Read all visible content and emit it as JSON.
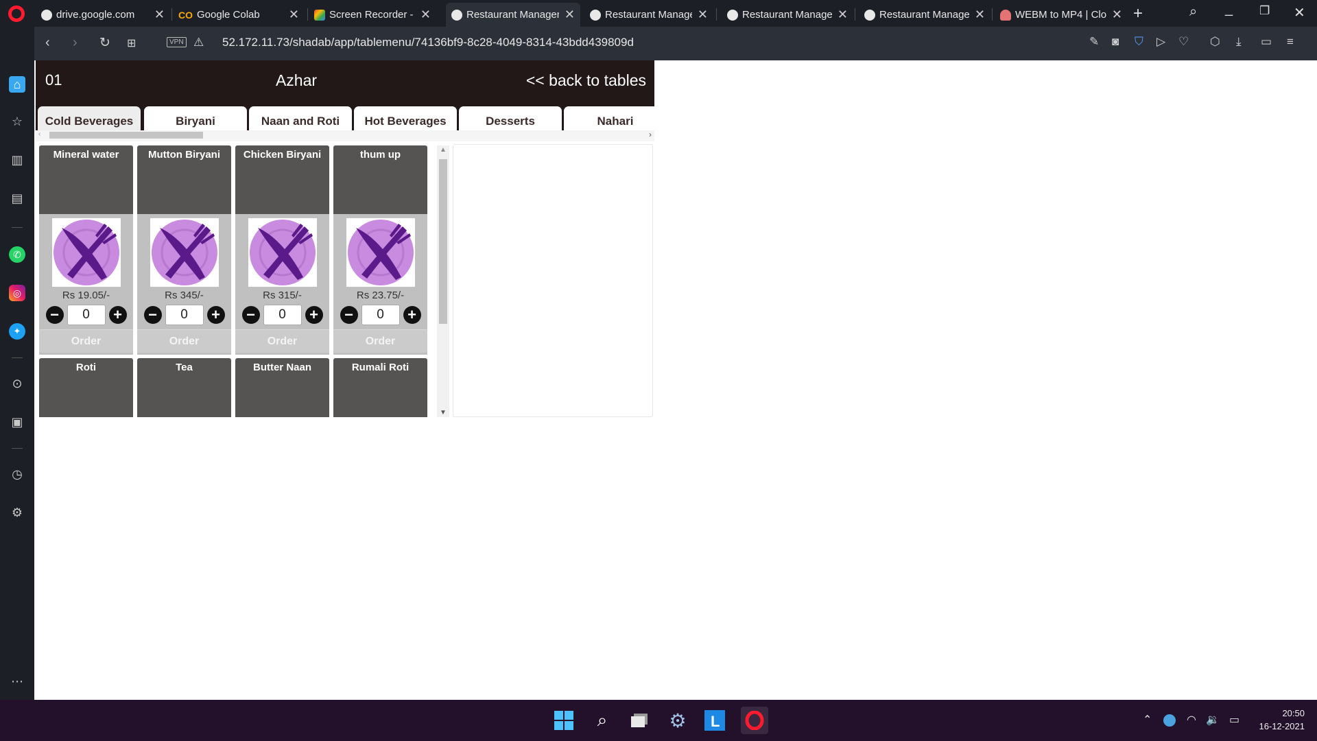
{
  "browser": {
    "tabs": [
      {
        "title": "drive.google.com",
        "icon": "globe-icon"
      },
      {
        "title": "Google Colab",
        "icon": "colab-icon",
        "icon_glyph": "CO"
      },
      {
        "title": "Screen Recorder - C",
        "icon": "screen-recorder-icon"
      },
      {
        "title": "Restaurant Manager",
        "icon": "globe-icon",
        "active": true
      },
      {
        "title": "Restaurant Manager",
        "icon": "globe-icon"
      },
      {
        "title": "Restaurant Manager",
        "icon": "globe-icon"
      },
      {
        "title": "Restaurant Manager",
        "icon": "globe-icon"
      },
      {
        "title": "WEBM to MP4 | Clo",
        "icon": "cloud-convert-icon"
      }
    ],
    "url": "52.172.11.73/shadab/app/tablemenu/74136bf9-8c28-4049-8314-43bdd439809d",
    "vpn_label": "VPN"
  },
  "header": {
    "table_number": "01",
    "waiter_name": "Azhar",
    "back_link": "<< back to tables"
  },
  "categories": [
    "Cold Beverages",
    "Biryani",
    "Naan and Roti",
    "Hot Beverages",
    "Desserts",
    "Nahari"
  ],
  "active_category": "Cold Beverages",
  "menu_items": [
    {
      "name": "Mineral water",
      "price": "Rs 19.05/-",
      "qty": "0",
      "order_label": "Order"
    },
    {
      "name": "Mutton Biryani",
      "price": "Rs 345/-",
      "qty": "0",
      "order_label": "Order"
    },
    {
      "name": "Chicken Biryani",
      "price": "Rs 315/-",
      "qty": "0",
      "order_label": "Order"
    },
    {
      "name": "thum up",
      "price": "Rs 23.75/-",
      "qty": "0",
      "order_label": "Order"
    },
    {
      "name": "Roti"
    },
    {
      "name": "Tea"
    },
    {
      "name": "Butter Naan"
    },
    {
      "name": "Rumali Roti"
    }
  ],
  "taskbar": {
    "time": "20:50",
    "date": "16-12-2021"
  },
  "colors": {
    "header_bg": "#221818",
    "card_head": "#555453",
    "card_body": "#c0c0c0",
    "plate_purple": "#c98be0",
    "utensil_purple": "#5a1a8a",
    "opera_red": "#ff1b2d",
    "taskbar_bg": "#23102a"
  }
}
